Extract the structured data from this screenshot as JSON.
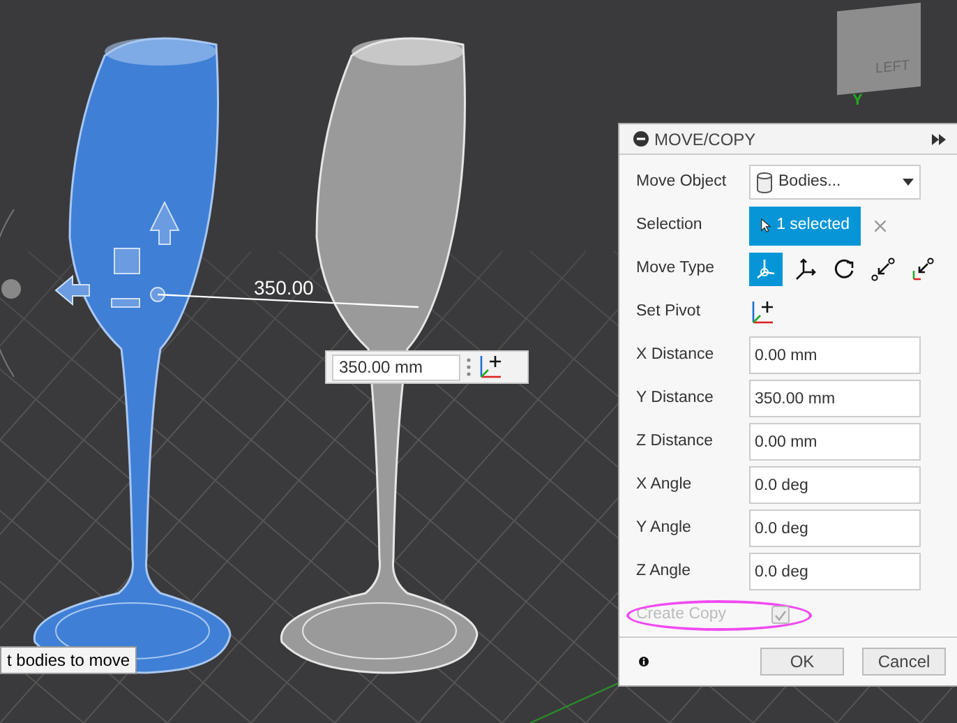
{
  "viewport": {
    "dimension_label": "350.00",
    "distance_input": {
      "value": "350.00 mm"
    },
    "tooltip": "t bodies to move",
    "view_cube": {
      "face_label": "LEFT",
      "axis_label": "Y"
    }
  },
  "panel": {
    "title": "MOVE/COPY",
    "rows": [
      {
        "kind": "dropdown",
        "label": "Move Object",
        "value": "Bodies..."
      },
      {
        "kind": "selection",
        "label": "Selection",
        "value": "1 selected"
      },
      {
        "kind": "move_types",
        "label": "Move Type",
        "options": [
          {
            "kind": "free",
            "selected": true
          },
          {
            "kind": "translate",
            "selected": false
          },
          {
            "kind": "rotate",
            "selected": false
          },
          {
            "kind": "point_to_point",
            "selected": false
          },
          {
            "kind": "point_to_position",
            "selected": false
          }
        ]
      },
      {
        "kind": "pivot",
        "label": "Set Pivot"
      },
      {
        "kind": "input",
        "label": "X Distance",
        "value": "0.00 mm"
      },
      {
        "kind": "input",
        "label": "Y Distance",
        "value": "350.00 mm"
      },
      {
        "kind": "input",
        "label": "Z Distance",
        "value": "0.00 mm"
      },
      {
        "kind": "input",
        "label": "X Angle",
        "value": "0.0 deg"
      },
      {
        "kind": "input",
        "label": "Y Angle",
        "value": "0.0 deg"
      },
      {
        "kind": "input",
        "label": "Z Angle",
        "value": "0.0 deg"
      },
      {
        "kind": "checkbox",
        "label": "Create Copy",
        "checked": true,
        "disabled": true,
        "highlighted": true
      }
    ],
    "buttons": [
      {
        "label": "OK"
      },
      {
        "label": "Cancel"
      }
    ]
  }
}
